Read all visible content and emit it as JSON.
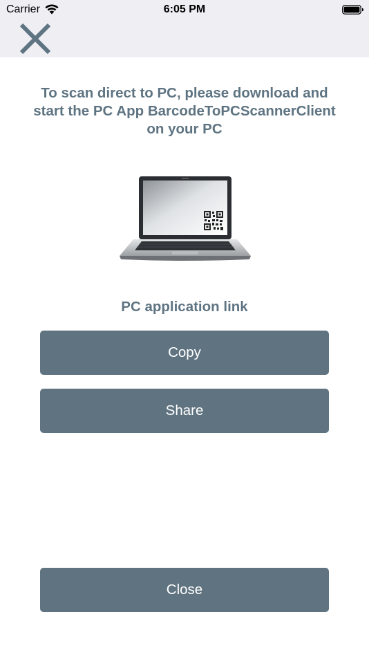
{
  "status_bar": {
    "carrier": "Carrier",
    "time": "6:05 PM"
  },
  "nav": {
    "close_icon": "close-x-icon"
  },
  "instructions": "To scan direct to PC, please download and start the PC App BarcodeToPCScannerClient on your PC",
  "link_label": "PC application link",
  "buttons": {
    "copy": "Copy",
    "share": "Share",
    "close": "Close"
  },
  "colors": {
    "accent": "#607380",
    "text": "#5f7482",
    "bar_bg": "#eeeef3"
  }
}
